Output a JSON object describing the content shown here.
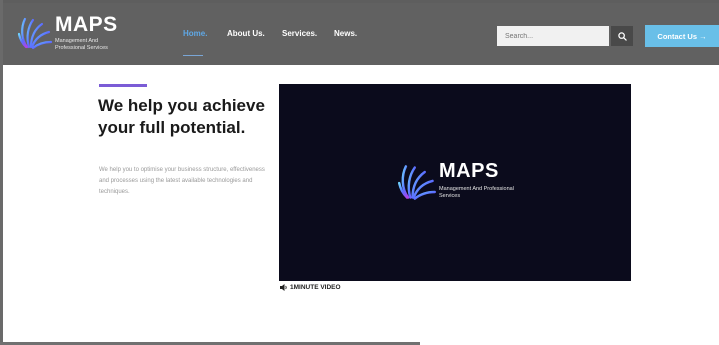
{
  "header": {
    "logo": {
      "word": "MAPS",
      "subtitle": "Management And Professional Services"
    },
    "nav": [
      {
        "label": "Home.",
        "active": true
      },
      {
        "label": "About Us."
      },
      {
        "label": "Services."
      },
      {
        "label": "News."
      }
    ],
    "search": {
      "placeholder": "Search...",
      "button_icon": "search-icon"
    },
    "contact_button": {
      "label": "Contact Us →"
    }
  },
  "hero": {
    "title": "We help you achieve your full potential.",
    "description": "We help you to optimise your business structure, effectiveness and processes using the latest available technologies and techniques."
  },
  "video": {
    "logo_word": "MAPS",
    "logo_subtitle": "Management And Professional Services",
    "caption": "1MINUTE VIDEO",
    "caption_icon": "speaker-icon"
  },
  "colors": {
    "header_bg": "#616161",
    "nav_active": "#5fa8e6",
    "contact_button": "#69bfe8",
    "accent_bar": "#7b5cd6",
    "video_bg": "#0b0b1c"
  }
}
